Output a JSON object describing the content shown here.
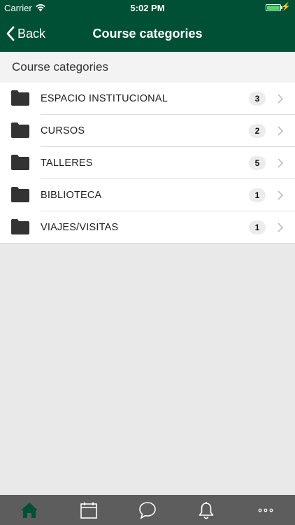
{
  "status_bar": {
    "carrier": "Carrier",
    "time": "5:02 PM"
  },
  "nav": {
    "back_label": "Back",
    "title": "Course categories"
  },
  "section": {
    "header": "Course categories"
  },
  "categories": [
    {
      "name": "ESPACIO INSTITUCIONAL",
      "count": "3"
    },
    {
      "name": "CURSOS",
      "count": "2"
    },
    {
      "name": "TALLERES",
      "count": "5"
    },
    {
      "name": "BIBLIOTECA",
      "count": "1"
    },
    {
      "name": "VIAJES/VISITAS",
      "count": "1"
    }
  ],
  "tab_bar": {
    "tabs": [
      {
        "icon": "home-icon",
        "active": true
      },
      {
        "icon": "calendar-icon",
        "active": false
      },
      {
        "icon": "chat-icon",
        "active": false
      },
      {
        "icon": "bell-icon",
        "active": false
      },
      {
        "icon": "more-icon",
        "active": false
      }
    ]
  },
  "colors": {
    "brand": "#005035",
    "tab_bar_bg": "#5d5d5d",
    "active_tab": "#005035",
    "inactive_tab": "#ffffff",
    "battery": "#4cd964"
  }
}
